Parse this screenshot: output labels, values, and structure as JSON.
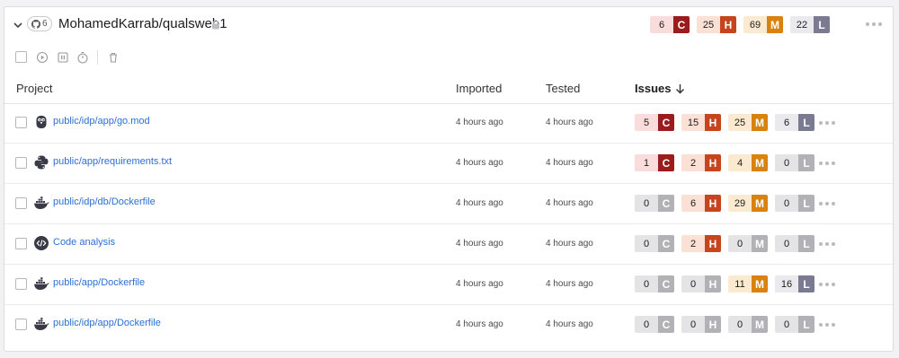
{
  "repo": {
    "name": "MohamedKarrab/qualsweb1",
    "project_count": "6",
    "issues": [
      {
        "count": "6",
        "letter": "C",
        "level": "critical"
      },
      {
        "count": "25",
        "letter": "H",
        "level": "high"
      },
      {
        "count": "69",
        "letter": "M",
        "level": "medium"
      },
      {
        "count": "22",
        "letter": "L",
        "level": "low"
      }
    ]
  },
  "columns": {
    "project": "Project",
    "imported": "Imported",
    "tested": "Tested",
    "issues": "Issues"
  },
  "colors": {
    "critical": {
      "bg": "#fbdcdc",
      "badge": "#9b1c1c"
    },
    "high": {
      "bg": "#fbe0d6",
      "badge": "#c7441c"
    },
    "medium": {
      "bg": "#fbeacf",
      "badge": "#d9820f"
    },
    "low": {
      "bg": "#e9e9ee",
      "badge": "#7b7a93"
    },
    "zero": {
      "bg": "#e4e4e7",
      "badge": "#b1b1b6"
    },
    "link": "#2d6fd3"
  },
  "projects": [
    {
      "icon": "gopher-icon",
      "name": "public/idp/app/go.mod",
      "imported": "4 hours ago",
      "tested": "4 hours ago",
      "issues": [
        {
          "count": "5",
          "letter": "C",
          "level": "critical"
        },
        {
          "count": "15",
          "letter": "H",
          "level": "high"
        },
        {
          "count": "25",
          "letter": "M",
          "level": "medium"
        },
        {
          "count": "6",
          "letter": "L",
          "level": "low"
        }
      ]
    },
    {
      "icon": "python-icon",
      "name": "public/app/requirements.txt",
      "imported": "4 hours ago",
      "tested": "4 hours ago",
      "issues": [
        {
          "count": "1",
          "letter": "C",
          "level": "critical"
        },
        {
          "count": "2",
          "letter": "H",
          "level": "high"
        },
        {
          "count": "4",
          "letter": "M",
          "level": "medium"
        },
        {
          "count": "0",
          "letter": "L",
          "level": "zero"
        }
      ]
    },
    {
      "icon": "docker-icon",
      "name": "public/idp/db/Dockerfile",
      "imported": "4 hours ago",
      "tested": "4 hours ago",
      "issues": [
        {
          "count": "0",
          "letter": "C",
          "level": "zero"
        },
        {
          "count": "6",
          "letter": "H",
          "level": "high"
        },
        {
          "count": "29",
          "letter": "M",
          "level": "medium"
        },
        {
          "count": "0",
          "letter": "L",
          "level": "zero"
        }
      ]
    },
    {
      "icon": "code-icon",
      "name": "Code analysis",
      "imported": "4 hours ago",
      "tested": "4 hours ago",
      "issues": [
        {
          "count": "0",
          "letter": "C",
          "level": "zero"
        },
        {
          "count": "2",
          "letter": "H",
          "level": "high"
        },
        {
          "count": "0",
          "letter": "M",
          "level": "zero"
        },
        {
          "count": "0",
          "letter": "L",
          "level": "zero"
        }
      ]
    },
    {
      "icon": "docker-icon",
      "name": "public/app/Dockerfile",
      "imported": "4 hours ago",
      "tested": "4 hours ago",
      "issues": [
        {
          "count": "0",
          "letter": "C",
          "level": "zero"
        },
        {
          "count": "0",
          "letter": "H",
          "level": "zero"
        },
        {
          "count": "11",
          "letter": "M",
          "level": "medium"
        },
        {
          "count": "16",
          "letter": "L",
          "level": "low"
        }
      ]
    },
    {
      "icon": "docker-icon",
      "name": "public/idp/app/Dockerfile",
      "imported": "4 hours ago",
      "tested": "4 hours ago",
      "issues": [
        {
          "count": "0",
          "letter": "C",
          "level": "zero"
        },
        {
          "count": "0",
          "letter": "H",
          "level": "zero"
        },
        {
          "count": "0",
          "letter": "M",
          "level": "zero"
        },
        {
          "count": "0",
          "letter": "L",
          "level": "zero"
        }
      ]
    }
  ]
}
